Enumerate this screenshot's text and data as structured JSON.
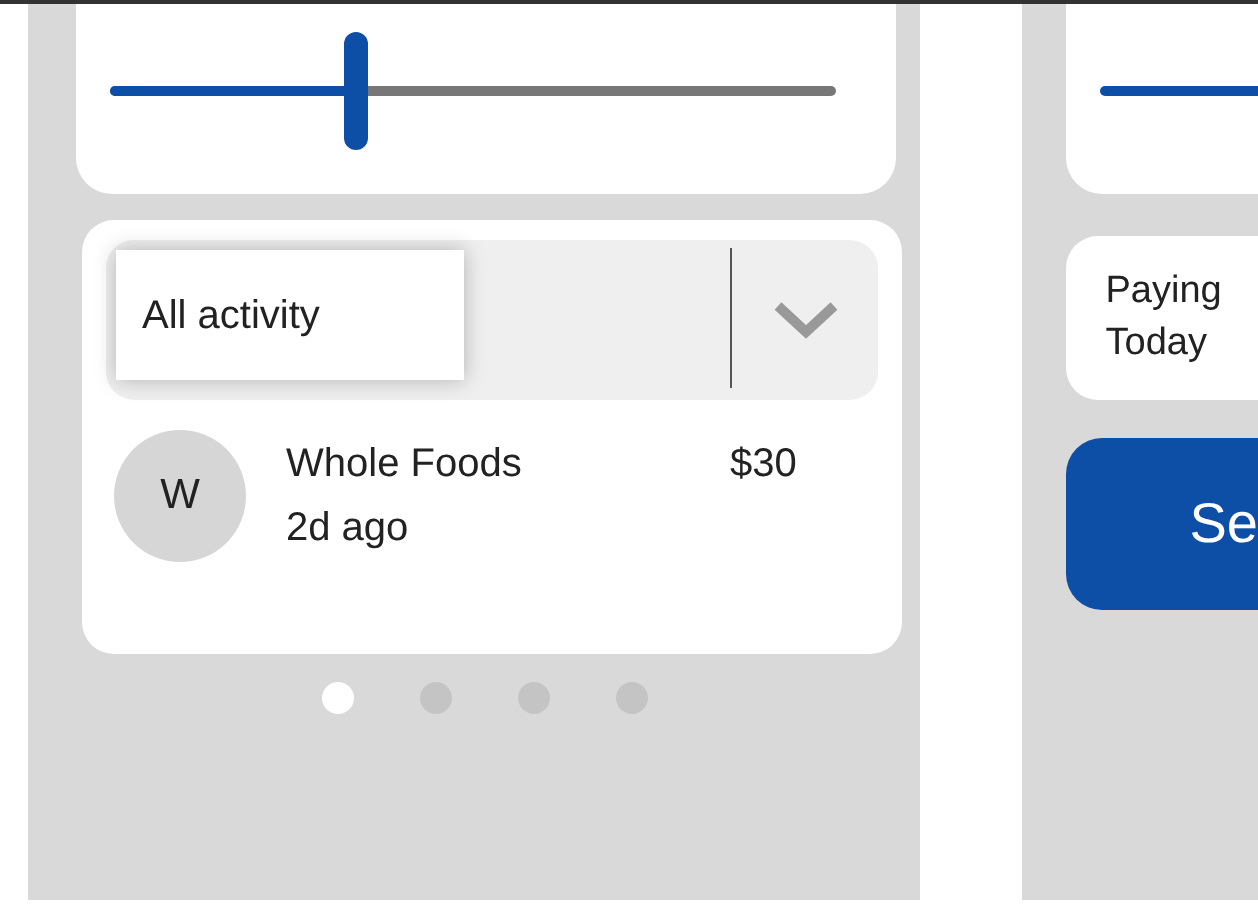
{
  "left_screen": {
    "slider": {
      "level": 0.34
    },
    "filter": {
      "value": "All activity"
    },
    "transactions": [
      {
        "initial": "W",
        "merchant": "Whole Foods",
        "time": "2d ago",
        "amount": "$30"
      }
    ],
    "page_dots": [
      {
        "selected": true
      },
      {
        "selected": false
      },
      {
        "selected": false
      },
      {
        "selected": false
      }
    ]
  },
  "right_screen": {
    "info_lines": [
      "Paying",
      "Today"
    ],
    "button": {
      "label": "Se"
    }
  }
}
